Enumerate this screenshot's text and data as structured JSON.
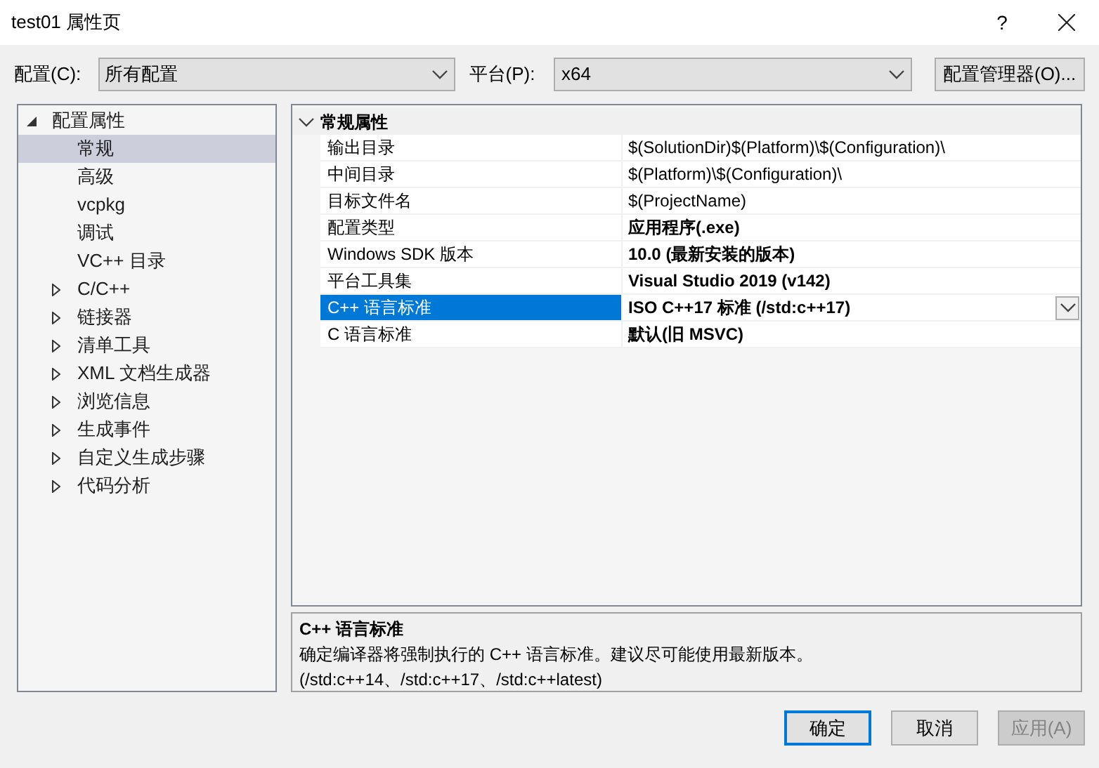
{
  "window": {
    "title": "test01 属性页",
    "help": "?"
  },
  "toolbar": {
    "configuration": {
      "label": "配置(C):",
      "value": "所有配置"
    },
    "platform": {
      "label": "平台(P):",
      "value": "x64"
    },
    "manager_button": "配置管理器(O)..."
  },
  "tree": [
    {
      "label": "配置属性",
      "expanded": true,
      "selected": false,
      "children": [
        {
          "label": "常规",
          "selected": true
        },
        {
          "label": "高级",
          "selected": false
        },
        {
          "label": "vcpkg",
          "selected": false
        },
        {
          "label": "调试",
          "selected": false
        },
        {
          "label": "VC++ 目录",
          "selected": false
        },
        {
          "label": "C/C++",
          "selected": false,
          "expanded": false
        },
        {
          "label": "链接器",
          "selected": false,
          "expanded": false
        },
        {
          "label": "清单工具",
          "selected": false,
          "expanded": false
        },
        {
          "label": "XML 文档生成器",
          "selected": false,
          "expanded": false
        },
        {
          "label": "浏览信息",
          "selected": false,
          "expanded": false
        },
        {
          "label": "生成事件",
          "selected": false,
          "expanded": false
        },
        {
          "label": "自定义生成步骤",
          "selected": false,
          "expanded": false
        },
        {
          "label": "代码分析",
          "selected": false,
          "expanded": false
        }
      ]
    }
  ],
  "grid": {
    "category": {
      "label": "常规属性",
      "expanded": true
    },
    "rows": [
      {
        "name": "输出目录",
        "value": "$(SolutionDir)$(Platform)\\$(Configuration)\\",
        "inherited": true,
        "selected": false
      },
      {
        "name": "中间目录",
        "value": "$(Platform)\\$(Configuration)\\",
        "inherited": true,
        "selected": false
      },
      {
        "name": "目标文件名",
        "value": "$(ProjectName)",
        "inherited": true,
        "selected": false
      },
      {
        "name": "配置类型",
        "value": "应用程序(.exe)",
        "inherited": false,
        "selected": false
      },
      {
        "name": "Windows SDK 版本",
        "value": "10.0 (最新安装的版本)",
        "inherited": false,
        "selected": false
      },
      {
        "name": "平台工具集",
        "value": "Visual Studio 2019 (v142)",
        "inherited": false,
        "selected": false
      },
      {
        "name": "C++ 语言标准",
        "value": "ISO C++17 标准 (/std:c++17)",
        "inherited": false,
        "selected": true
      },
      {
        "name": "C 语言标准",
        "value": "默认(旧 MSVC)",
        "inherited": false,
        "selected": false
      }
    ]
  },
  "description": {
    "title": "C++ 语言标准",
    "text": "确定编译器将强制执行的 C++ 语言标准。建议尽可能使用最新版本。(/std:c++14、/std:c++17、/std:c++latest)"
  },
  "buttons": [
    {
      "label": "确定",
      "default": true,
      "disabled": false
    },
    {
      "label": "取消",
      "default": false,
      "disabled": false
    },
    {
      "label": "应用(A)",
      "default": false,
      "disabled": true
    }
  ]
}
